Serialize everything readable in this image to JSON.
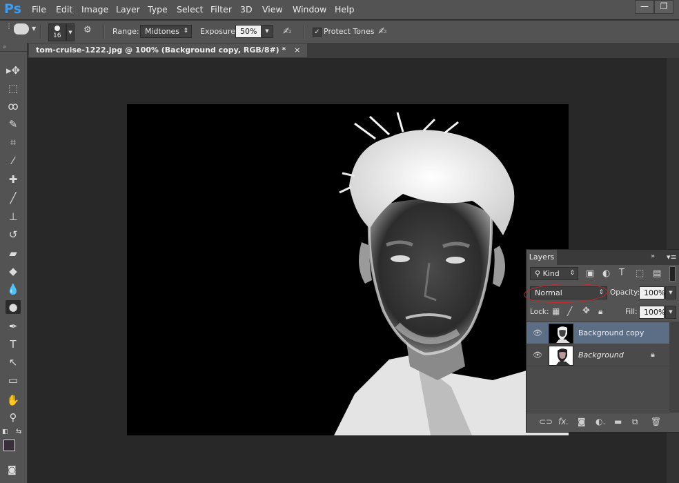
{
  "app": {
    "logo": "Ps"
  },
  "menu": [
    "File",
    "Edit",
    "Image",
    "Layer",
    "Type",
    "Select",
    "Filter",
    "3D",
    "View",
    "Window",
    "Help"
  ],
  "window_controls": {
    "minimize": "—",
    "restore": "❐"
  },
  "options_bar": {
    "brush_size": "16",
    "range_label": "Range:",
    "range_value": "Midtones",
    "exposure_label": "Exposure:",
    "exposure_value": "50%",
    "protect_tones_label": "Protect Tones",
    "protect_tones_checked": true
  },
  "document_tab": {
    "title": "tom-cruise-1222.jpg @ 100% (Background copy, RGB/8#) *",
    "close": "×"
  },
  "toolbar": {
    "tools": [
      {
        "name": "move-tool-icon",
        "glyph": "▸✥"
      },
      {
        "name": "marquee-tool-icon",
        "glyph": "⬚"
      },
      {
        "name": "lasso-tool-icon",
        "glyph": "ꝏ"
      },
      {
        "name": "quick-selection-tool-icon",
        "glyph": "✎"
      },
      {
        "name": "crop-tool-icon",
        "glyph": "⌗"
      },
      {
        "name": "eyedropper-tool-icon",
        "glyph": "⁄"
      },
      {
        "name": "healing-brush-tool-icon",
        "glyph": "✚"
      },
      {
        "name": "brush-tool-icon",
        "glyph": "╱"
      },
      {
        "name": "clone-stamp-tool-icon",
        "glyph": "⊥"
      },
      {
        "name": "history-brush-tool-icon",
        "glyph": "↺"
      },
      {
        "name": "eraser-tool-icon",
        "glyph": "▰"
      },
      {
        "name": "paint-bucket-tool-icon",
        "glyph": "◆"
      },
      {
        "name": "blur-tool-icon",
        "glyph": "💧"
      },
      {
        "name": "sponge-tool-icon",
        "glyph": "●"
      },
      {
        "name": "pen-tool-icon",
        "glyph": "✒"
      },
      {
        "name": "type-tool-icon",
        "glyph": "T"
      },
      {
        "name": "path-selection-tool-icon",
        "glyph": "↖"
      },
      {
        "name": "rectangle-tool-icon",
        "glyph": "▭"
      },
      {
        "name": "hand-tool-icon",
        "glyph": "✋"
      },
      {
        "name": "zoom-tool-icon",
        "glyph": "⚲"
      }
    ],
    "foreground_color": "#3a2d3a",
    "background_color": "#ffffff"
  },
  "layers_panel": {
    "tab": "Layers",
    "filter_kind": "Kind",
    "blend_mode": "Normal",
    "opacity_label": "Opacity:",
    "opacity_value": "100%",
    "lock_label": "Lock:",
    "fill_label": "Fill:",
    "fill_value": "100%",
    "layers": [
      {
        "name": "Background copy",
        "selected": true,
        "visible": true,
        "locked": false
      },
      {
        "name": "Background",
        "selected": false,
        "visible": true,
        "locked": true
      }
    ],
    "footer_icons": [
      "link-icon",
      "fx-icon",
      "mask-icon",
      "adjustment-icon",
      "folder-icon",
      "new-layer-icon",
      "trash-icon"
    ]
  },
  "colors": {
    "ui_panel": "#535353",
    "workspace": "#282828",
    "selected_layer": "#5b6e86",
    "annotation_circle": "#c8262a"
  }
}
